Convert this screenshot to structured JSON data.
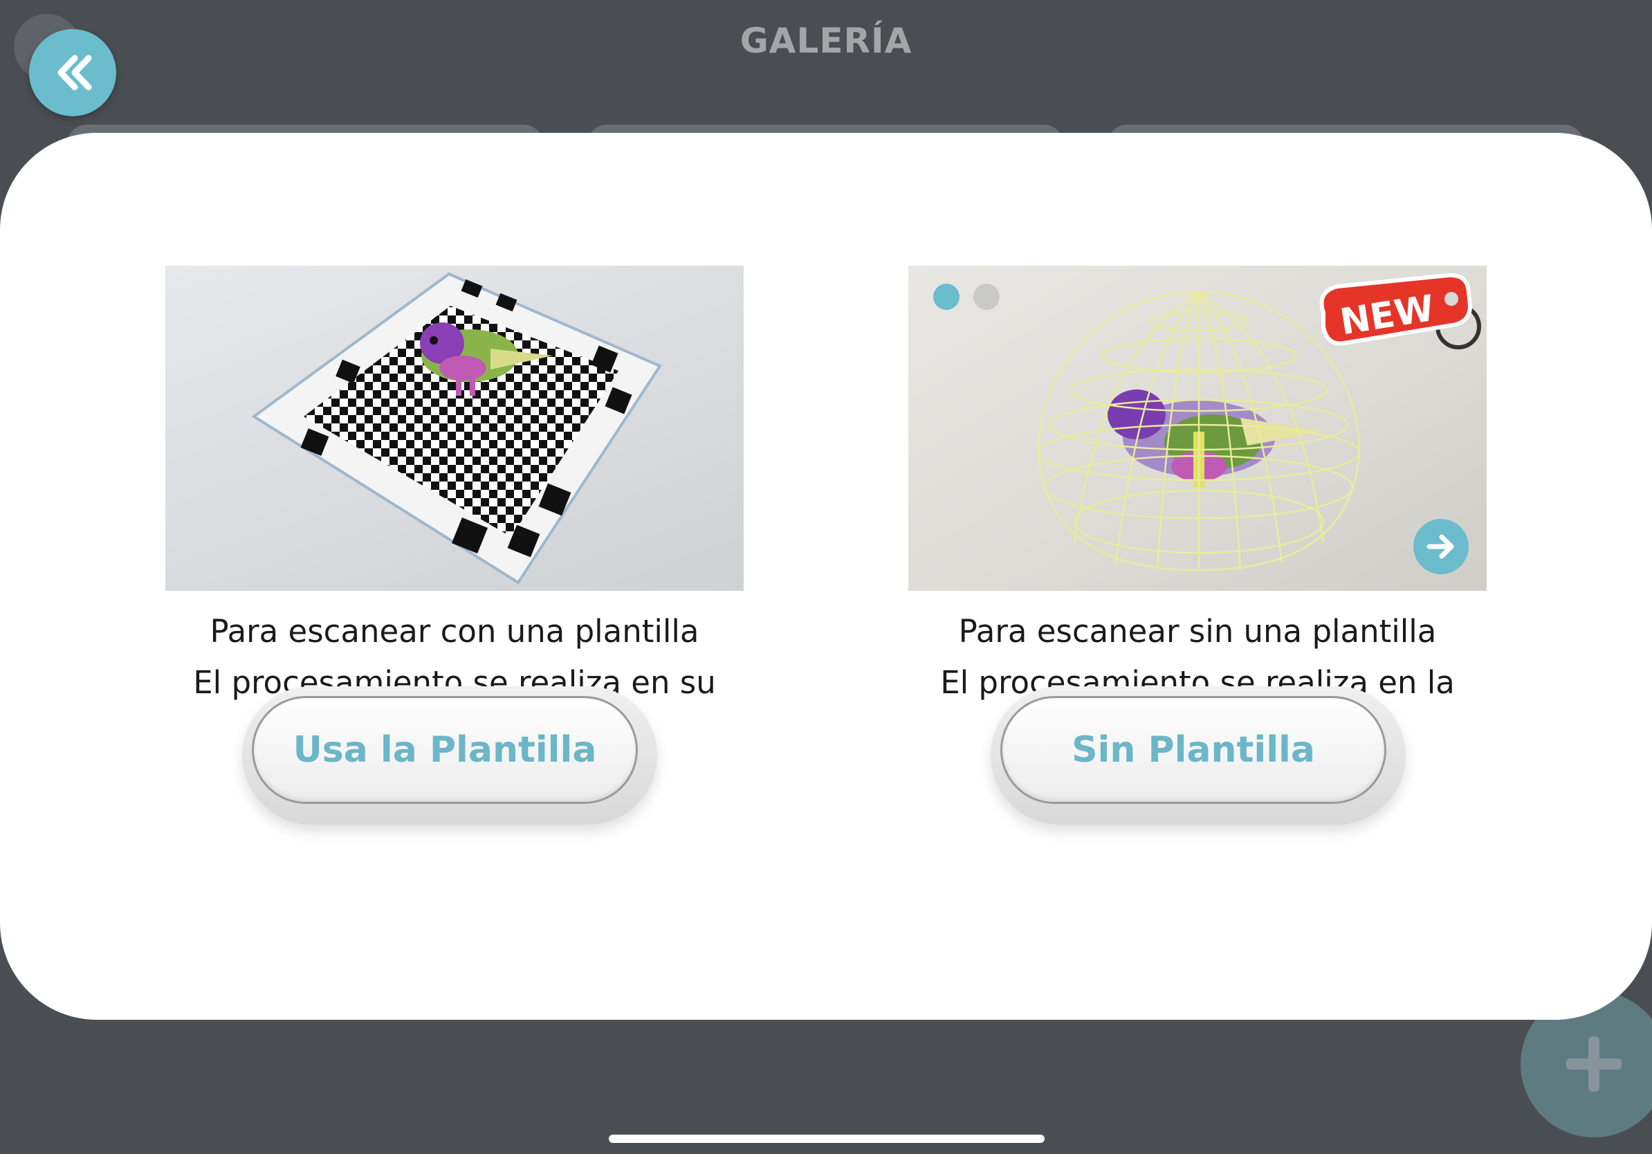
{
  "header": {
    "title": "GALERÍA"
  },
  "options": [
    {
      "line1": "Para escanear con una plantilla",
      "line2": "El procesamiento se realiza en su dispositivo",
      "button_label": "Usa la Plantilla"
    },
    {
      "line1": "Para escanear sin una plantilla",
      "line2": "El procesamiento se realiza en la Cloud",
      "button_label": "Sin Plantilla",
      "badge": "NEW"
    }
  ],
  "icons": {
    "back": "double-chevron-left-icon",
    "add": "plus-icon",
    "next": "arrow-right-icon"
  },
  "colors": {
    "accent": "#6bbccd",
    "background": "#4a4e52",
    "modal": "#ffffff",
    "badge": "#e53528"
  }
}
